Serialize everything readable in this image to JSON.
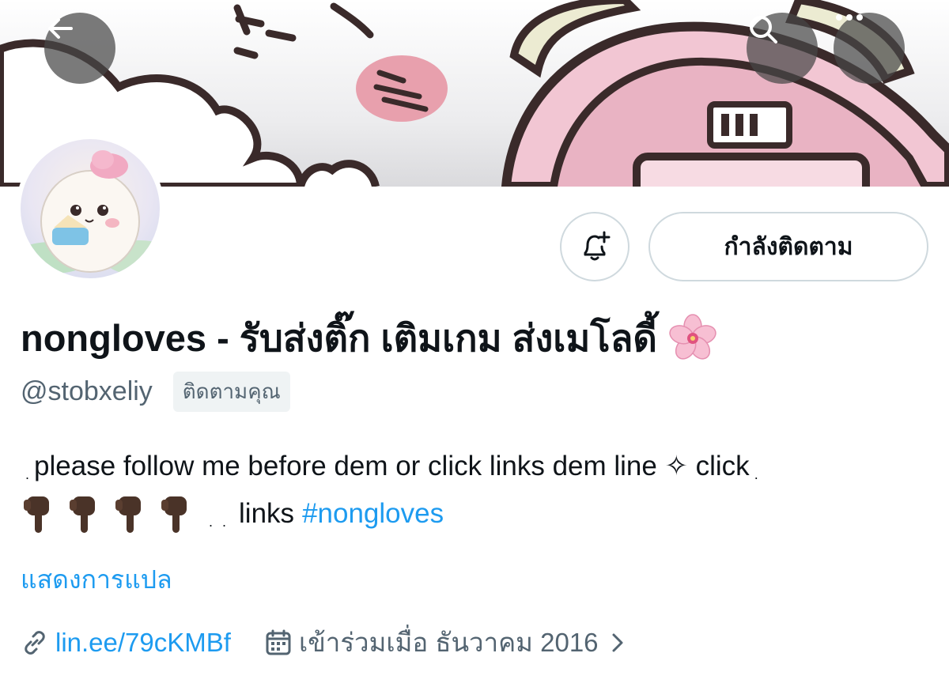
{
  "header": {
    "back_icon": "arrow-left-icon",
    "search_icon": "search-icon",
    "more_icon": "more-horizontal-icon"
  },
  "profile": {
    "display_name": "nongloves - รับส่งติ๊ก เติมเกม ส่งเมโลดี้",
    "name_emoji": "cherry-blossom-icon",
    "handle": "@stobxeliy",
    "follows_you_badge": "ติดตามคุณ",
    "following_button": "กำลังติดตาม",
    "notify_icon": "bell-plus-icon",
    "bio_line1": "please follow me before dem or click links dem line ✧ click",
    "bio_line2_text": "links",
    "bio_hashtag": "#nongloves",
    "bio_emoji": "pointing-down-hand-icon",
    "translate_link": "แสดงการแปล",
    "website": "lin.ee/79cKMBf",
    "joined": "เข้าร่วมเมื่อ ธันวาคม 2016"
  },
  "colors": {
    "accent": "#1d9bf0",
    "secondary_text": "#536471",
    "primary_text": "#0f1419",
    "border": "#cfd9de"
  }
}
